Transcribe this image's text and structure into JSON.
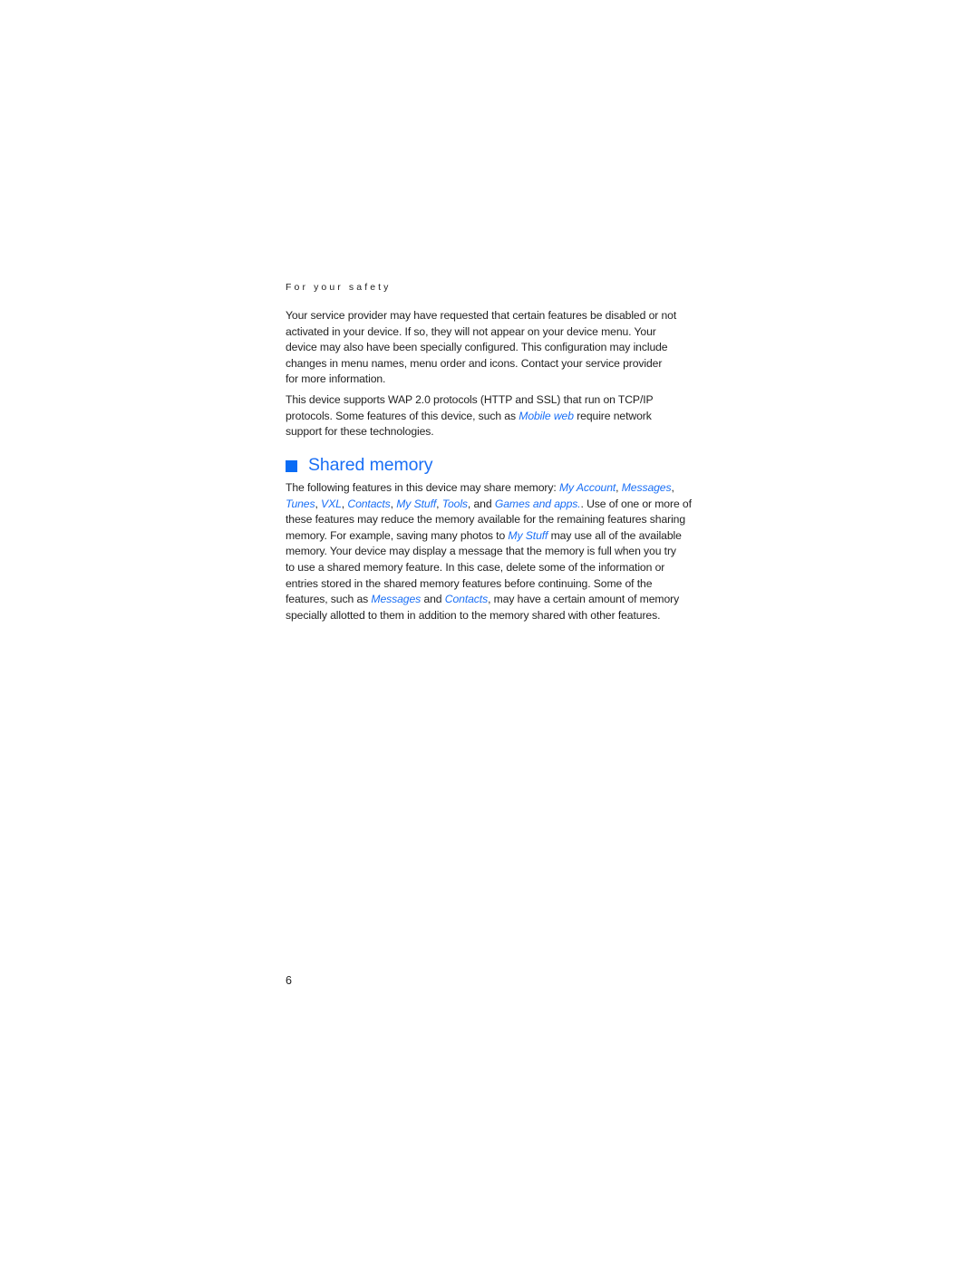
{
  "header": {
    "running_head": "For your safety"
  },
  "paragraph_1": {
    "lines": [
      "Your service provider may have requested that certain features be disabled or not",
      "activated in your device. If so, they will not appear on your device menu. Your",
      "device may also have been specially configured. This configuration may include",
      "changes in menu names, menu order and icons. Contact your service provider",
      "for more information."
    ]
  },
  "paragraph_2": {
    "line1": "This device supports WAP 2.0 protocols (HTTP and SSL) that run on TCP/IP",
    "line2_pre": "protocols. Some features of this device, such as ",
    "line2_link": "Mobile web",
    "line2_post": " require network",
    "line3": "support for these technologies."
  },
  "section": {
    "icon": "blue-square-bullet",
    "title": "Shared memory",
    "accent_color": "#1a6ff5"
  },
  "paragraph_3": {
    "l1_pre": "The following features in this device may share memory: ",
    "l1_link1": "My Account",
    "l1_sep": ", ",
    "l1_link2": "Messages",
    "l1_end": ",",
    "l2_link1": "Tunes",
    "l2_sep1": ", ",
    "l2_link2": "VXL",
    "l2_sep2": ", ",
    "l2_link3": "Contacts",
    "l2_sep3": ", ",
    "l2_link4": "My Stuff",
    "l2_sep4": ", ",
    "l2_link5": "Tools",
    "l2_sep5": ", and ",
    "l2_link6": "Games and apps.",
    "l2_post": ". Use of one or more of",
    "l3": "these features may reduce the memory available for the remaining features sharing",
    "l4_pre": "memory. For example, saving many photos to ",
    "l4_link": "My Stuff",
    "l4_post": " may use all of the available",
    "l5": "memory. Your device may display a message that the memory is full when you try",
    "l6": "to use a shared memory feature. In this case, delete some of the information or",
    "l7": "entries stored in the shared memory features before continuing. Some of the",
    "l8_pre": "features, such as ",
    "l8_link1": "Messages",
    "l8_mid": " and ",
    "l8_link2": "Contacts",
    "l8_post": ", may have a certain amount of memory",
    "l9": "specially allotted to them in addition to the memory shared with other features."
  },
  "footer": {
    "page_number": "6"
  }
}
